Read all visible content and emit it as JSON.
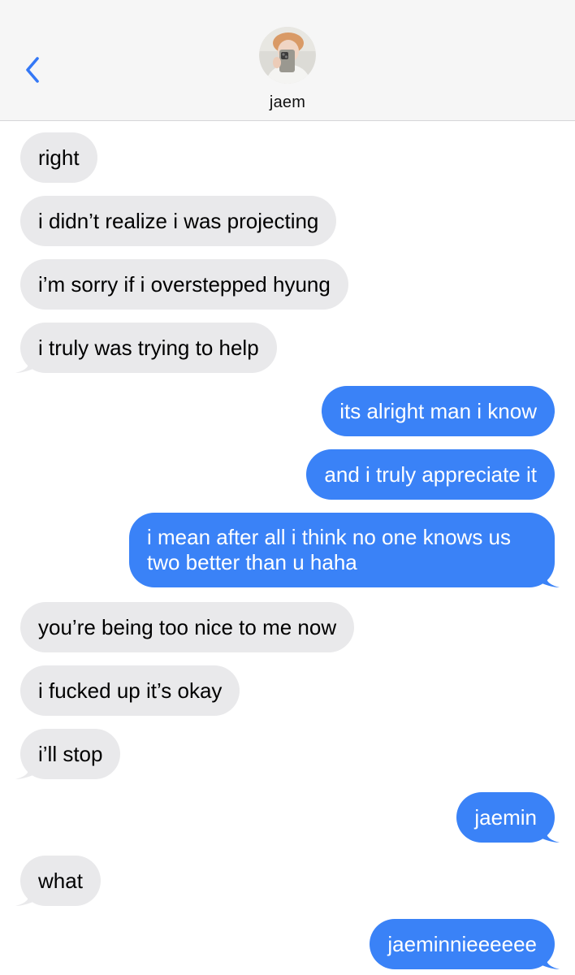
{
  "header": {
    "back_icon": "chevron-left-icon",
    "contact_name": "jaem",
    "avatar_icon": "contact-avatar-photo"
  },
  "colors": {
    "incoming_bubble": "#e9e9eb",
    "outgoing_bubble": "#3a82f7",
    "accent": "#3478f6",
    "header_bg": "#f6f6f6"
  },
  "messages": [
    {
      "direction": "incoming",
      "text": "right"
    },
    {
      "direction": "incoming",
      "text": "i didn’t realize i was projecting"
    },
    {
      "direction": "incoming",
      "text": "i’m sorry if i overstepped hyung"
    },
    {
      "direction": "incoming",
      "text": "i truly was trying to help"
    },
    {
      "direction": "outgoing",
      "text": "its alright man i know"
    },
    {
      "direction": "outgoing",
      "text": "and i truly appreciate it"
    },
    {
      "direction": "outgoing",
      "text": "i mean after all i think no one knows us two better than u haha"
    },
    {
      "direction": "incoming",
      "text": "you’re being too nice to me now"
    },
    {
      "direction": "incoming",
      "text": "i fucked up it’s okay"
    },
    {
      "direction": "incoming",
      "text": "i’ll stop"
    },
    {
      "direction": "outgoing",
      "text": "jaemin"
    },
    {
      "direction": "incoming",
      "text": "what"
    },
    {
      "direction": "outgoing",
      "text": "jaeminnieeeeee"
    }
  ]
}
